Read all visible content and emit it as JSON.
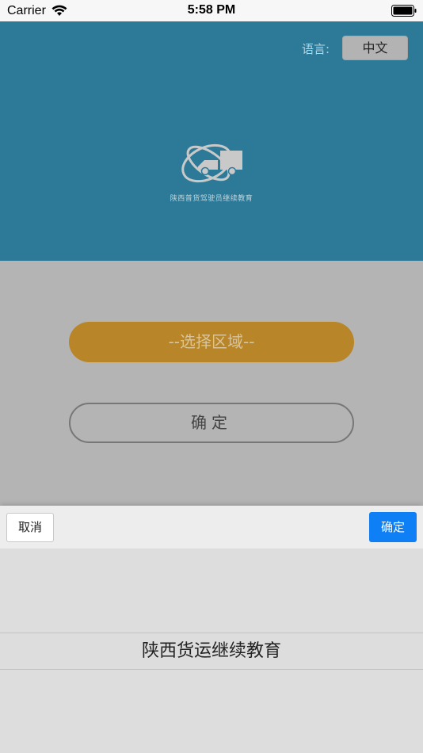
{
  "status_bar": {
    "carrier": "Carrier",
    "time": "5:58 PM"
  },
  "header": {
    "language_label": "语言:",
    "language_value": "中文",
    "logo_text": "陕西普货驾驶员继续教育",
    "background_color": "#2d7a98"
  },
  "main": {
    "region_select_label": "--选择区域--",
    "region_select_color": "#b88628",
    "confirm_label": "确定"
  },
  "picker": {
    "cancel_label": "取消",
    "done_label": "确定",
    "done_color": "#0f7ff5",
    "options": [
      "陕西货运继续教育"
    ]
  }
}
